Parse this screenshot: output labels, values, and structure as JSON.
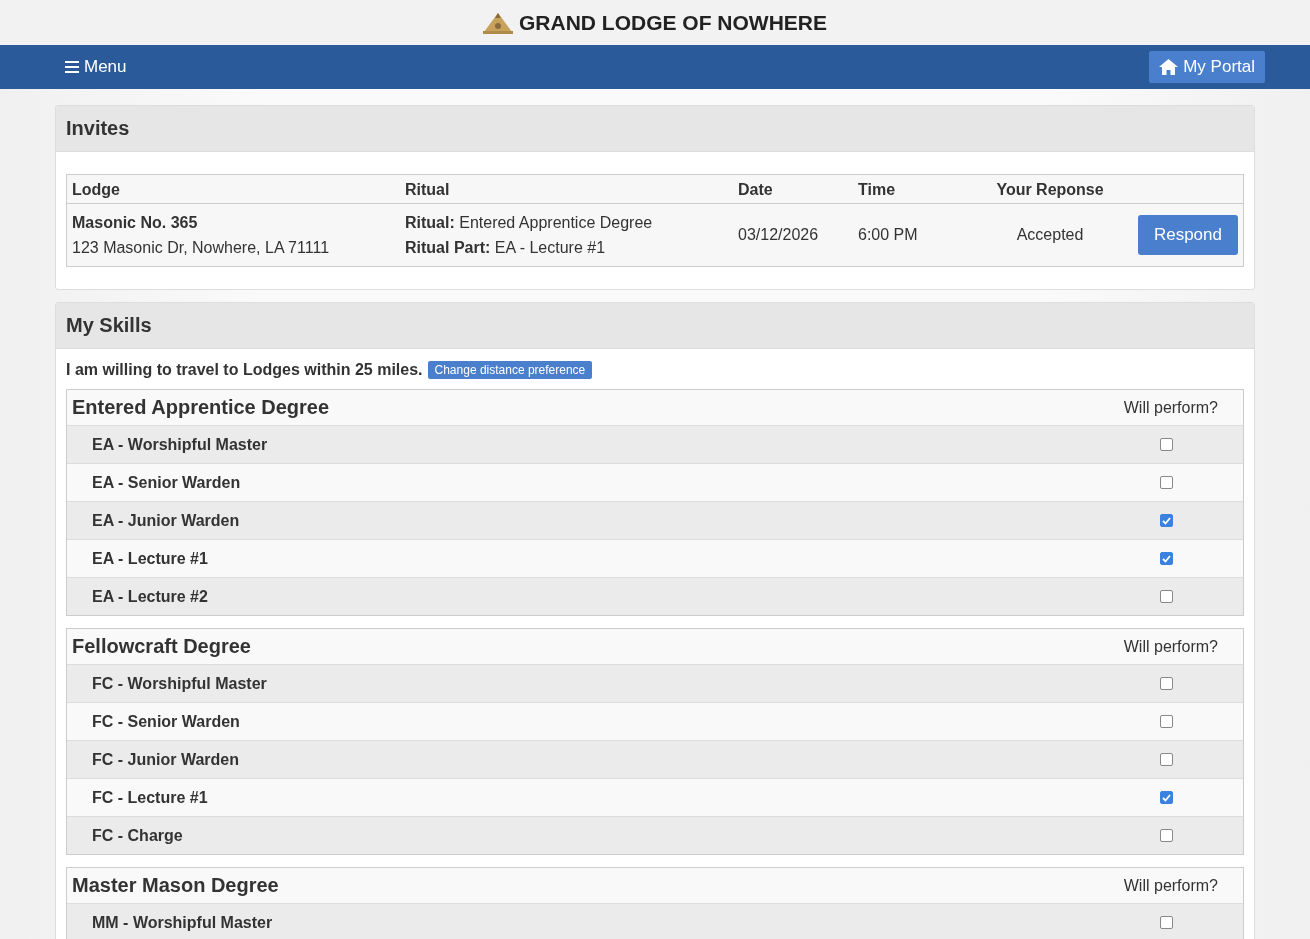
{
  "brand": {
    "title": "GRAND LODGE OF NOWHERE"
  },
  "nav": {
    "menu_label": "Menu",
    "portal_label": "My Portal"
  },
  "invites": {
    "title": "Invites",
    "columns": [
      "Lodge",
      "Ritual",
      "Date",
      "Time",
      "Your Reponse"
    ],
    "rows": [
      {
        "lodge_name": "Masonic No. 365",
        "lodge_address": "123 Masonic Dr, Nowhere, LA 71111",
        "ritual": "**Ritual:** Entered Apprentice Degree",
        "ritual_part": "**Ritual Part:** EA - Lecture #1",
        "date": "03/12/2026",
        "time": "6:00 PM",
        "response": "Accepted",
        "action": "Respond"
      }
    ]
  },
  "skills": {
    "title": "My Skills",
    "distance_text": "I am willing to travel to Lodges within 25 miles.",
    "distance_button": "Change distance preference",
    "degrees": [
      {
        "name": "Entered Apprentice Degree",
        "column_label": "Will perform?",
        "parts": [
          {
            "label": "EA - Worshipful Master",
            "checked": false
          },
          {
            "label": "EA - Senior Warden",
            "checked": false
          },
          {
            "label": "EA - Junior Warden",
            "checked": true
          },
          {
            "label": "EA - Lecture #1",
            "checked": true
          },
          {
            "label": "EA - Lecture #2",
            "checked": false
          }
        ]
      },
      {
        "name": "Fellowcraft Degree",
        "column_label": "Will perform?",
        "parts": [
          {
            "label": "FC - Worshipful Master",
            "checked": false
          },
          {
            "label": "FC - Senior Warden",
            "checked": false
          },
          {
            "label": "FC - Junior Warden",
            "checked": false
          },
          {
            "label": "FC - Lecture #1",
            "checked": true
          },
          {
            "label": "FC - Charge",
            "checked": false
          }
        ]
      },
      {
        "name": "Master Mason Degree",
        "column_label": "Will perform?",
        "parts": [
          {
            "label": "MM - Worshipful Master",
            "checked": false
          }
        ]
      }
    ]
  }
}
